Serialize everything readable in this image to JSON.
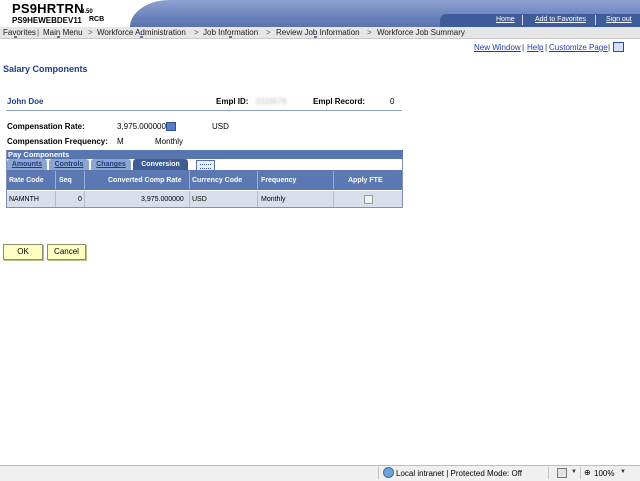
{
  "header": {
    "app_name": "PS9HRTRN",
    "app_version": "8.50",
    "database": "PS9HEWEBDEV11",
    "node": "RCB",
    "links": [
      "Home",
      "Add to Favorites",
      "Sign out"
    ]
  },
  "nav": {
    "items": [
      "Favorites",
      "Main Menu",
      "Workforce Administration",
      "Job Information",
      "Review Job Information",
      "Workforce Job Summary"
    ],
    "separator": ">"
  },
  "page_links": {
    "new_window": "New Window",
    "help": "Help",
    "customize_page": "Customize Page"
  },
  "page": {
    "title": "Salary Components",
    "employee_name": "John Doe",
    "empl_id_label": "Empl ID:",
    "empl_id_value": "0110576",
    "empl_record_label": "Empl Record:",
    "empl_record_value": "0",
    "comp_rate_label": "Compensation Rate:",
    "comp_rate_value": "3,975.000000",
    "currency": "USD",
    "comp_freq_label": "Compensation Frequency:",
    "comp_freq_code": "M",
    "comp_freq_desc": "Monthly"
  },
  "grid": {
    "title": "Pay Components",
    "tabs": [
      "Amounts",
      "Controls",
      "Changes",
      "Conversion"
    ],
    "active_tab": "Conversion",
    "columns": [
      "Rate Code",
      "Seq",
      "Converted Comp Rate",
      "Currency Code",
      "Frequency",
      "Apply FTE"
    ],
    "rows": [
      {
        "rate_code": "NAMNTH",
        "seq": "0",
        "converted_rate": "3,975.000000",
        "currency": "USD",
        "frequency": "Monthly",
        "apply_fte": false
      }
    ]
  },
  "buttons": {
    "ok": "OK",
    "cancel": "Cancel"
  },
  "status_bar": {
    "zone": "Local intranet | Protected Mode: Off",
    "zoom": "100%"
  },
  "colors": {
    "header_blue": "#6f86bf",
    "accent_blue": "#1f3c88",
    "button_yellow": "#ffffc4",
    "grid_header": "#5b78b3"
  }
}
